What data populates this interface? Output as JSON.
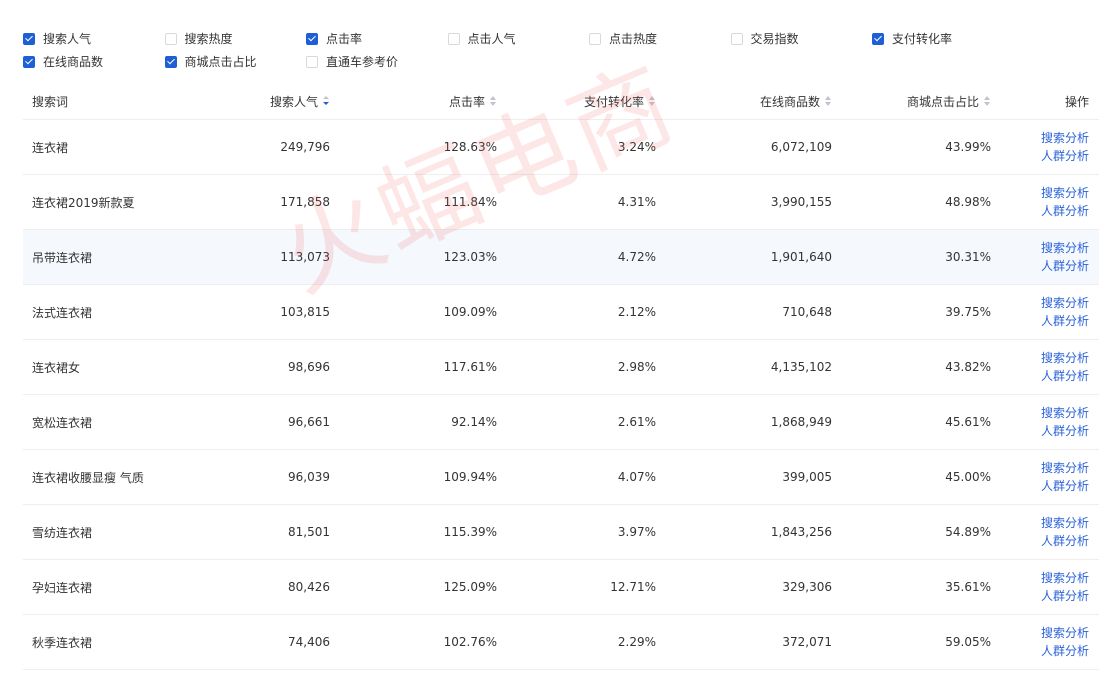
{
  "filters": {
    "row1": [
      {
        "label": "搜索人气",
        "checked": true
      },
      {
        "label": "搜索热度",
        "checked": false
      },
      {
        "label": "点击率",
        "checked": true
      },
      {
        "label": "点击人气",
        "checked": false
      },
      {
        "label": "点击热度",
        "checked": false
      },
      {
        "label": "交易指数",
        "checked": false
      },
      {
        "label": "支付转化率",
        "checked": true
      }
    ],
    "row2": [
      {
        "label": "在线商品数",
        "checked": true
      },
      {
        "label": "商城点击占比",
        "checked": true
      },
      {
        "label": "直通车参考价",
        "checked": false
      }
    ]
  },
  "table": {
    "headers": {
      "keyword": "搜索词",
      "search_popularity": "搜索人气",
      "click_rate": "点击率",
      "pay_conversion": "支付转化率",
      "online_items": "在线商品数",
      "mall_click_share": "商城点击占比",
      "actions": "操作"
    },
    "action_labels": {
      "search_analysis": "搜索分析",
      "crowd_analysis": "人群分析"
    },
    "rows": [
      {
        "keyword": "连衣裙",
        "search_popularity": "249,796",
        "click_rate": "128.63%",
        "pay_conversion": "3.24%",
        "online_items": "6,072,109",
        "mall_click_share": "43.99%"
      },
      {
        "keyword": "连衣裙2019新款夏",
        "search_popularity": "171,858",
        "click_rate": "111.84%",
        "pay_conversion": "4.31%",
        "online_items": "3,990,155",
        "mall_click_share": "48.98%"
      },
      {
        "keyword": "吊带连衣裙",
        "search_popularity": "113,073",
        "click_rate": "123.03%",
        "pay_conversion": "4.72%",
        "online_items": "1,901,640",
        "mall_click_share": "30.31%"
      },
      {
        "keyword": "法式连衣裙",
        "search_popularity": "103,815",
        "click_rate": "109.09%",
        "pay_conversion": "2.12%",
        "online_items": "710,648",
        "mall_click_share": "39.75%"
      },
      {
        "keyword": "连衣裙女",
        "search_popularity": "98,696",
        "click_rate": "117.61%",
        "pay_conversion": "2.98%",
        "online_items": "4,135,102",
        "mall_click_share": "43.82%"
      },
      {
        "keyword": "宽松连衣裙",
        "search_popularity": "96,661",
        "click_rate": "92.14%",
        "pay_conversion": "2.61%",
        "online_items": "1,868,949",
        "mall_click_share": "45.61%"
      },
      {
        "keyword": "连衣裙收腰显瘦 气质",
        "search_popularity": "96,039",
        "click_rate": "109.94%",
        "pay_conversion": "4.07%",
        "online_items": "399,005",
        "mall_click_share": "45.00%"
      },
      {
        "keyword": "雪纺连衣裙",
        "search_popularity": "81,501",
        "click_rate": "115.39%",
        "pay_conversion": "3.97%",
        "online_items": "1,843,256",
        "mall_click_share": "54.89%"
      },
      {
        "keyword": "孕妇连衣裙",
        "search_popularity": "80,426",
        "click_rate": "125.09%",
        "pay_conversion": "12.71%",
        "online_items": "329,306",
        "mall_click_share": "35.61%"
      },
      {
        "keyword": "秋季连衣裙",
        "search_popularity": "74,406",
        "click_rate": "102.76%",
        "pay_conversion": "2.29%",
        "online_items": "372,071",
        "mall_click_share": "59.05%"
      }
    ],
    "highlighted_row": 2
  },
  "watermark": "火蝠电商",
  "colors": {
    "accent": "#1f5fd6",
    "link": "#2b63d9",
    "highlight_row": "#f5f8fd",
    "watermark": "#f06464"
  }
}
